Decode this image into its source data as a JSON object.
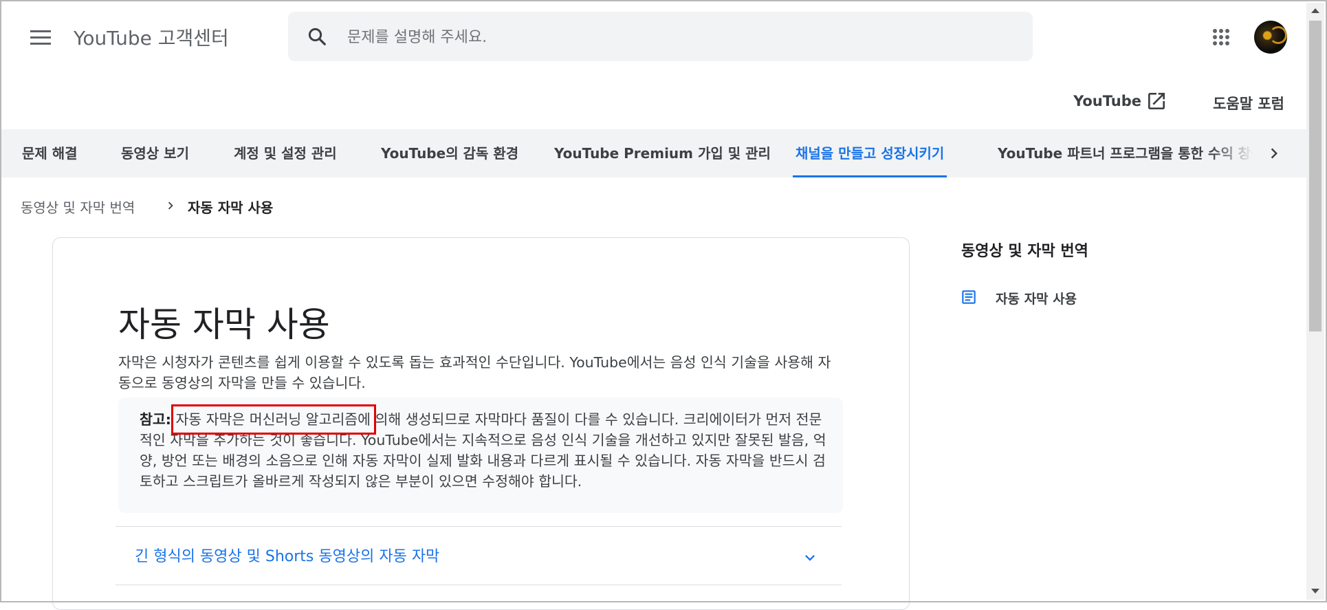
{
  "header": {
    "menu_icon": "hamburger-menu-icon",
    "title": "YouTube 고객센터",
    "search_placeholder": "문제를 설명해 주세요.",
    "search_icon": "search-icon",
    "apps_icon": "apps-grid-icon",
    "avatar_icon": "account-avatar"
  },
  "links": {
    "youtube": "YouTube",
    "external_icon": "open-in-new-icon",
    "forum": "도움말 포럼"
  },
  "nav": {
    "tabs": [
      {
        "label": "문제 해결",
        "active": false
      },
      {
        "label": "동영상 보기",
        "active": false
      },
      {
        "label": "계정 및 설정 관리",
        "active": false
      },
      {
        "label": "YouTube의 감독 환경",
        "active": false
      },
      {
        "label": "YouTube Premium 가입 및 관리",
        "active": false
      },
      {
        "label": "채널을 만들고 성장시키기",
        "active": true
      },
      {
        "label": "YouTube 파트너 프로그램을 통한 수익 창출",
        "active": false
      }
    ],
    "next_icon": "chevron-right-icon"
  },
  "breadcrumb": {
    "parent": "동영상 및 자막 번역",
    "current": "자동 자막 사용"
  },
  "article": {
    "title": "자동 자막 사용",
    "intro": "자막은 시청자가 콘텐츠를 쉽게 이용할 수 있도록 돕는 효과적인 수단입니다. YouTube에서는 음성 인식 기술을 사용해 자동으로 동영상의 자막을 만들 수 있습니다.",
    "note_label": "참고:",
    "note_text": " 자동 자막은 머신러닝 알고리즘에 의해 생성되므로 자막마다 품질이 다를 수 있습니다. 크리에이터가 먼저 전문적인 자막을 추가하는 것이 좋습니다. YouTube에서는 지속적으로 음성 인식 기술을 개선하고 있지만 잘못된 발음, 억양, 방언 또는 배경의 소음으로 인해 자동 자막이 실제 발화 내용과 다르게 표시될 수 있습니다. 자동 자막을 반드시 검토하고 스크립트가 올바르게 작성되지 않은 부분이 있으면 수정해야 합니다.",
    "accordion_label": "긴 형식의 동영상 및 Shorts 동영상의 자동 자막",
    "accordion_icon": "expand-more-icon"
  },
  "sidebar": {
    "title": "동영상 및 자막 번역",
    "items": [
      {
        "label": "자동 자막 사용",
        "icon": "article-icon"
      }
    ]
  },
  "colors": {
    "accent": "#1a73e8",
    "highlight_box": "#e00000",
    "nav_background": "#f1f3f4"
  }
}
